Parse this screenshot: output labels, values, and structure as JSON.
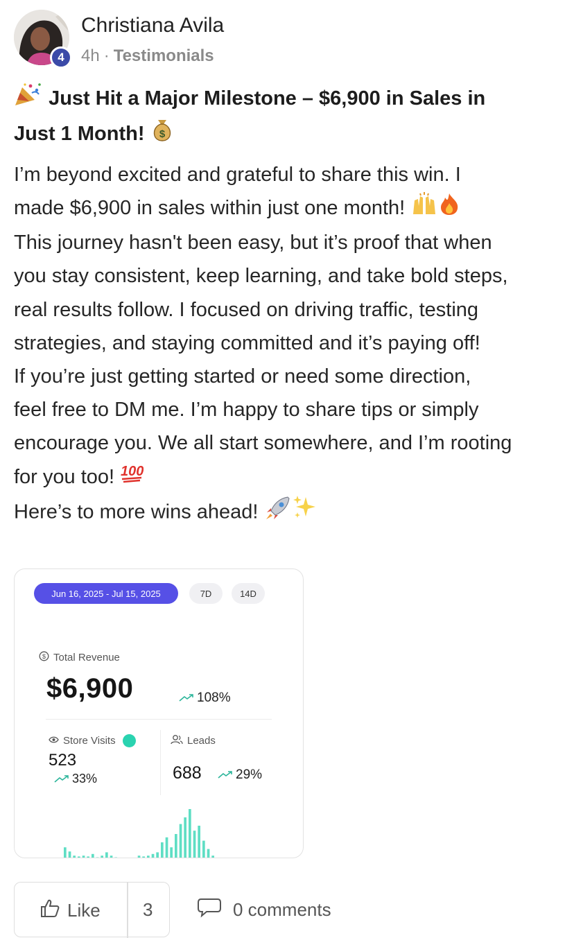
{
  "post": {
    "author": "Christiana Avila",
    "level": "4",
    "time": "4h",
    "separator": "·",
    "category": "Testimonials",
    "title_line1": "Just Hit a Major Milestone – $6,900 in Sales in",
    "title_line2": "Just 1 Month!",
    "body_lines": [
      "I’m beyond excited and grateful to share this win. I",
      "made $6,900 in sales within just one month!",
      "This journey hasn't been easy, but it’s proof that when",
      "you stay consistent, keep learning, and take bold steps,",
      "real results follow. I focused on driving traffic, testing",
      "strategies, and staying committed and it’s paying off!",
      "If you’re just getting started or need some direction,",
      "feel free to DM me. I’m happy to share tips or simply",
      "encourage you. We all start somewhere, and I’m rooting",
      "for you too!",
      "Here’s to more wins ahead!"
    ],
    "icons": [
      "party-popper-icon",
      "money-bag-icon",
      "raised-hands-icon",
      "fire-icon",
      "hundred-points-icon",
      "rocket-icon",
      "sparkles-icon"
    ]
  },
  "screenshot": {
    "date_range": "Jun 16, 2025 - Jul 15, 2025",
    "range_7d": "7D",
    "range_14d": "14D",
    "revenue_label": "Total Revenue",
    "revenue_value": "$6,900",
    "revenue_change": "108%",
    "visits_label": "Store Visits",
    "visits_value": "523",
    "visits_change": "33%",
    "leads_label": "Leads",
    "leads_value": "688",
    "leads_change": "29%",
    "accent_color": "#5650e6",
    "trend_color": "#2ad3b0",
    "sparkline_values": [
      14,
      9,
      4,
      3,
      4,
      3,
      6,
      2,
      4,
      8,
      4,
      2,
      1,
      0,
      0,
      0,
      4,
      3,
      4,
      6,
      8,
      20,
      26,
      14,
      30,
      42,
      50,
      60,
      34,
      40,
      22,
      12,
      4
    ]
  },
  "footer": {
    "like_label": "Like",
    "like_count": "3",
    "comments_label": "0 comments"
  }
}
